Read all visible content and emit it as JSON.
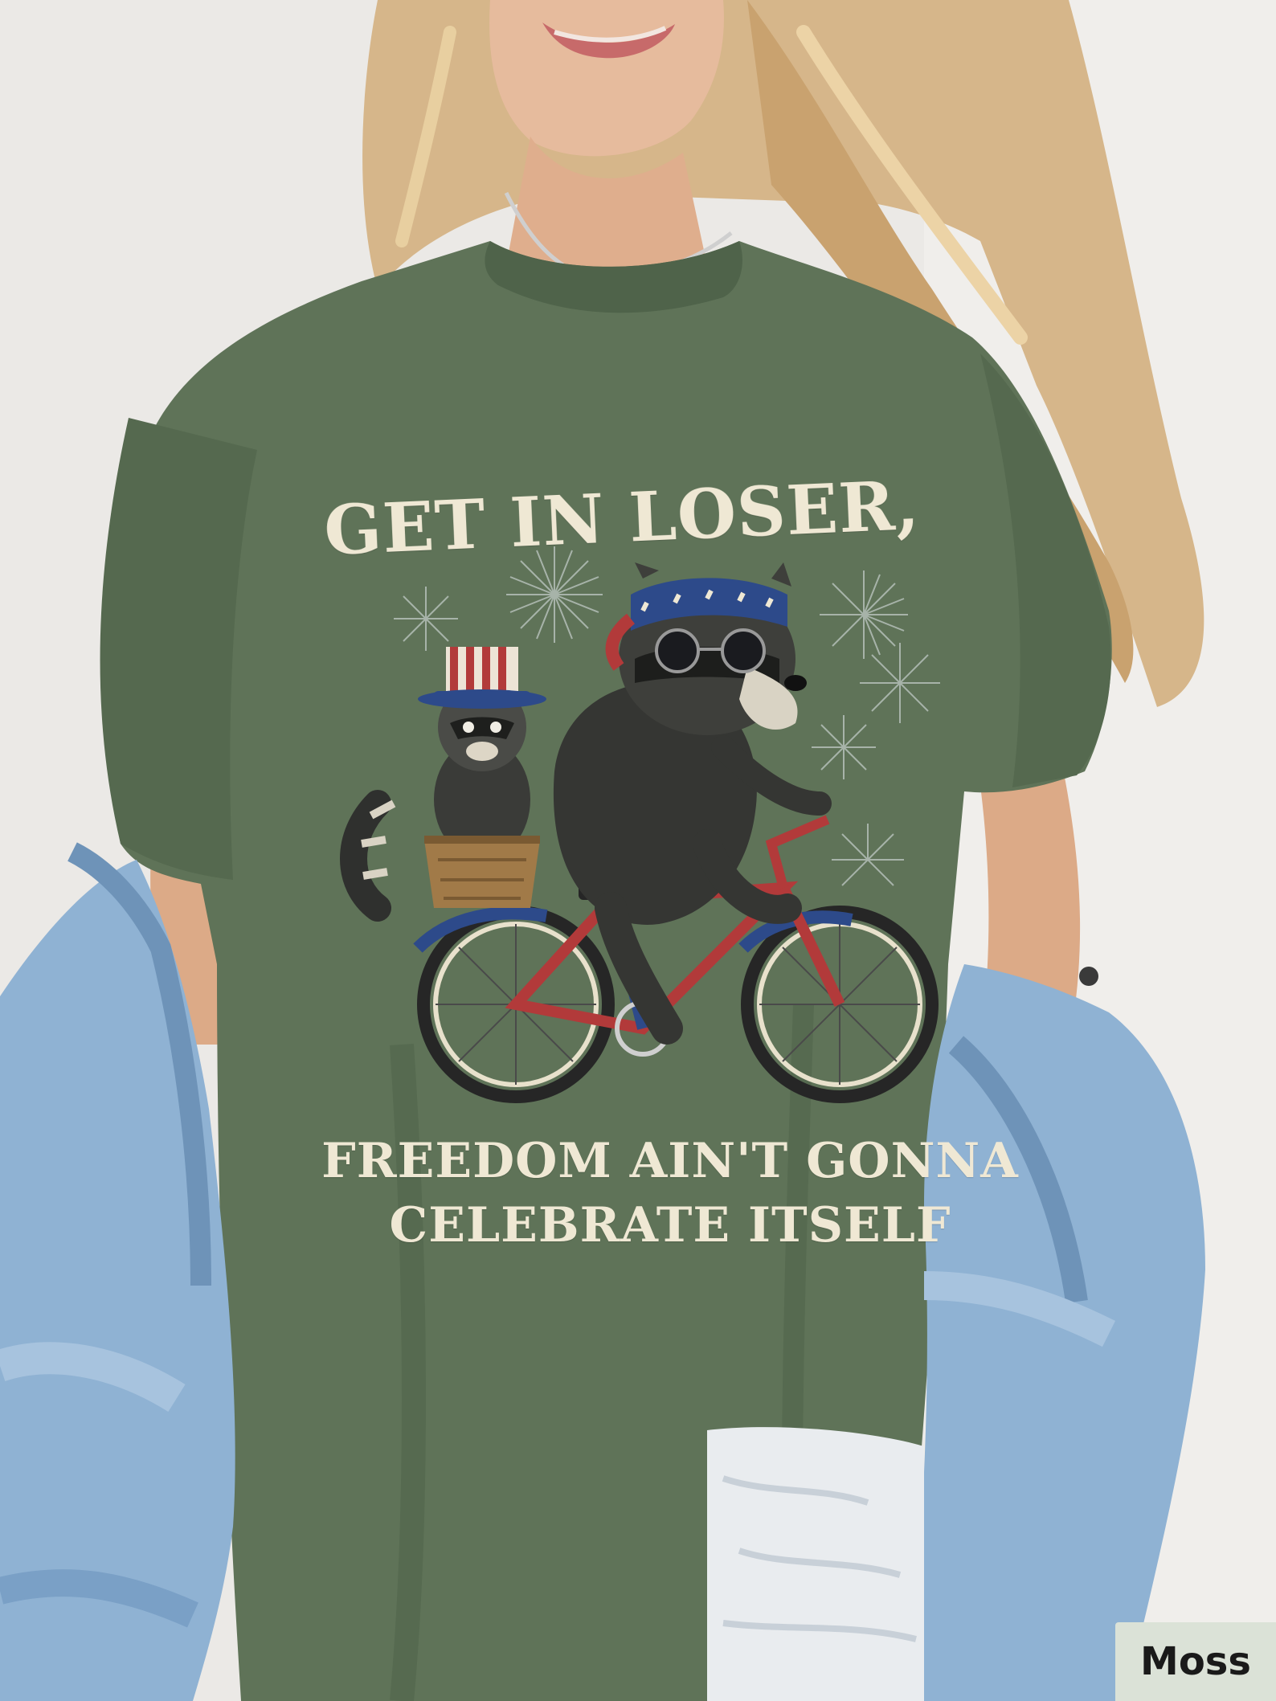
{
  "shirt": {
    "headline": "GET IN LOSER,",
    "tagline_line1": "FREEDOM AIN'T GONNA",
    "tagline_line2": "CELEBRATE ITSELF"
  },
  "color_badge": {
    "label": "Moss"
  },
  "colors": {
    "background": "#e9e7e3",
    "shirt_moss": "#5f7358",
    "print_cream": "#efe8d4",
    "denim": "#8fb2d3",
    "bike_red": "#b23a3a",
    "bike_blue": "#2d4a8a",
    "raccoon_dark": "#2f302e",
    "hair": "#d8b98a",
    "skin": "#e3b79a"
  }
}
